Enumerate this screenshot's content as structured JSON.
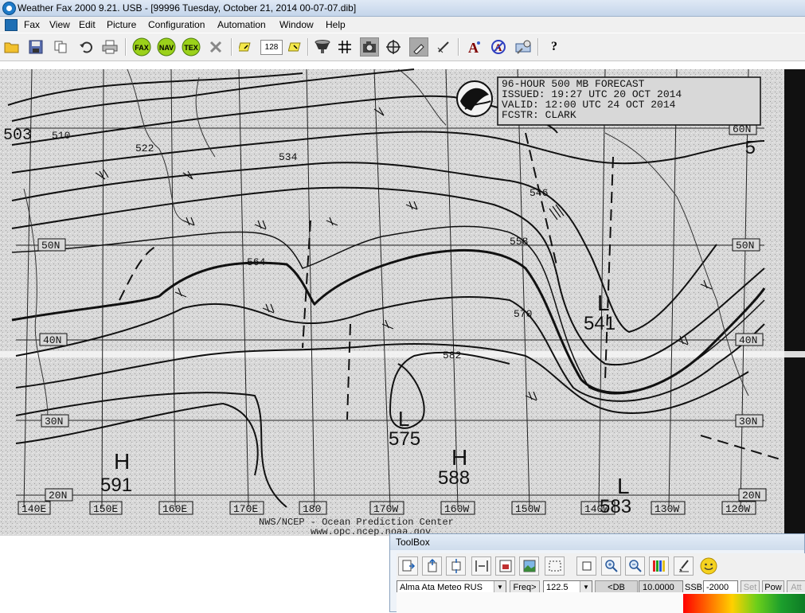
{
  "window": {
    "title": "Weather Fax 2000 9.21. USB  - [99996 Tuesday, October 21, 2014 00-07-07.dib]"
  },
  "menu": [
    "Fax",
    "View",
    "Edit",
    "Picture",
    "Configuration",
    "Automation",
    "Window",
    "Help"
  ],
  "toolbar": {
    "gain_value": "128",
    "fax_label": "FAX",
    "nav_label": "NAV",
    "tex_label": "TEX"
  },
  "fax_chart": {
    "header_lines": [
      "96-HOUR 500 MB FORECAST",
      "ISSUED: 19:27 UTC 20 OCT 2014",
      "VALID:  12:00 UTC 24 OCT 2014",
      "FCSTR:  CLARK"
    ],
    "longitudes": [
      "140E",
      "150E",
      "160E",
      "170E",
      "180",
      "170W",
      "160W",
      "150W",
      "140W",
      "130W",
      "120W"
    ],
    "latitudes_left": [
      "50N",
      "40N",
      "30N",
      "20N"
    ],
    "latitudes_right": [
      "60N",
      "50N",
      "40N",
      "30N",
      "20N"
    ],
    "contour_labels": [
      "510",
      "522",
      "534",
      "546",
      "558",
      "564",
      "570",
      "582"
    ],
    "systems": [
      {
        "letter": "H",
        "value": "591"
      },
      {
        "letter": "L",
        "value": "575"
      },
      {
        "letter": "H",
        "value": "588"
      },
      {
        "letter": "L",
        "value": "541"
      },
      {
        "letter": "L",
        "value": "583"
      }
    ],
    "edge_left": "503",
    "edge_right": "5",
    "footer_line1": "NWS/NCEP - Ocean Prediction Center",
    "footer_line2": "www.opc.ncep.noaa.gov"
  },
  "toolbox": {
    "title": "ToolBox",
    "station": "Alma Ata Meteo RUS",
    "freq_label": "Freq>",
    "freq_value": "122.5",
    "db_rec_label": "<DB REC>",
    "db_value": "10.0000",
    "mode_label": "SSB",
    "offset_value": "-2000",
    "set_label": "Set",
    "pow_label": "Pow",
    "att_label": "Att"
  },
  "colors": {
    "titlebar": "#c4d5ea",
    "menubar": "#f0f0f0",
    "fax_paper": "#d9d9d9",
    "fax_ink": "#111111"
  }
}
